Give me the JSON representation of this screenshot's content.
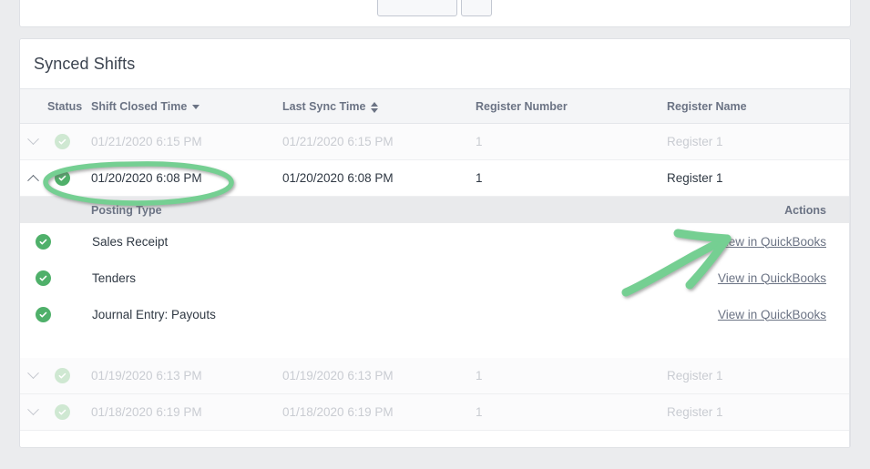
{
  "page": {
    "background_color": "#ebecee",
    "card_background": "#ffffff"
  },
  "top_card": {
    "buttons": [
      {
        "label": "",
        "name": "top-primary-button"
      },
      {
        "label": "",
        "name": "top-secondary-button"
      }
    ]
  },
  "card": {
    "title": "Synced Shifts"
  },
  "table": {
    "columns": [
      {
        "key": "caret",
        "label": ""
      },
      {
        "key": "status",
        "label": "Status",
        "sort": "none"
      },
      {
        "key": "closed",
        "label": "Shift Closed Time",
        "sort": "desc"
      },
      {
        "key": "sync",
        "label": "Last Sync Time",
        "sort": "both"
      },
      {
        "key": "regnum",
        "label": "Register Number",
        "sort": "none"
      },
      {
        "key": "regname",
        "label": "Register Name",
        "sort": "none"
      }
    ],
    "rows": [
      {
        "expanded": false,
        "dim": true,
        "status": "synced",
        "closed_time": "01/21/2020 6:15 PM",
        "last_sync_time": "01/21/2020 6:15 PM",
        "register_number": "1",
        "register_name": "Register 1"
      },
      {
        "expanded": true,
        "dim": false,
        "status": "synced",
        "closed_time": "01/20/2020 6:08 PM",
        "last_sync_time": "01/20/2020 6:08 PM",
        "register_number": "1",
        "register_name": "Register 1"
      },
      {
        "expanded": false,
        "dim": true,
        "status": "synced",
        "closed_time": "01/19/2020 6:13 PM",
        "last_sync_time": "01/19/2020 6:13 PM",
        "register_number": "1",
        "register_name": "Register 1"
      },
      {
        "expanded": false,
        "dim": true,
        "status": "synced",
        "closed_time": "01/18/2020 6:19 PM",
        "last_sync_time": "01/18/2020 6:19 PM",
        "register_number": "1",
        "register_name": "Register 1"
      }
    ]
  },
  "detail": {
    "headers": {
      "posting_type": "Posting Type",
      "actions": "Actions"
    },
    "items": [
      {
        "status": "synced",
        "posting_type": "Sales Receipt",
        "action_label": "View in QuickBooks"
      },
      {
        "status": "synced",
        "posting_type": "Tenders",
        "action_label": "View in QuickBooks"
      },
      {
        "status": "synced",
        "posting_type": "Journal Entry: Payouts",
        "action_label": "View in QuickBooks"
      }
    ]
  },
  "colors": {
    "status_green": "#4fb06a",
    "status_green_faded": "#cfe8d2",
    "annotation_green": "#74cf92",
    "header_text": "#6b7384",
    "body_text": "#2f3843",
    "dim_text": "#c9ccd2",
    "subheader_bg": "#e9eaec",
    "header_bg": "#f4f5f7"
  },
  "annotations": [
    {
      "type": "ellipse",
      "name": "highlight-ellipse-shift-closed-time",
      "color": "#74cf92"
    },
    {
      "type": "arrow",
      "name": "highlight-arrow-view-in-quickbooks",
      "color": "#74cf92"
    }
  ]
}
